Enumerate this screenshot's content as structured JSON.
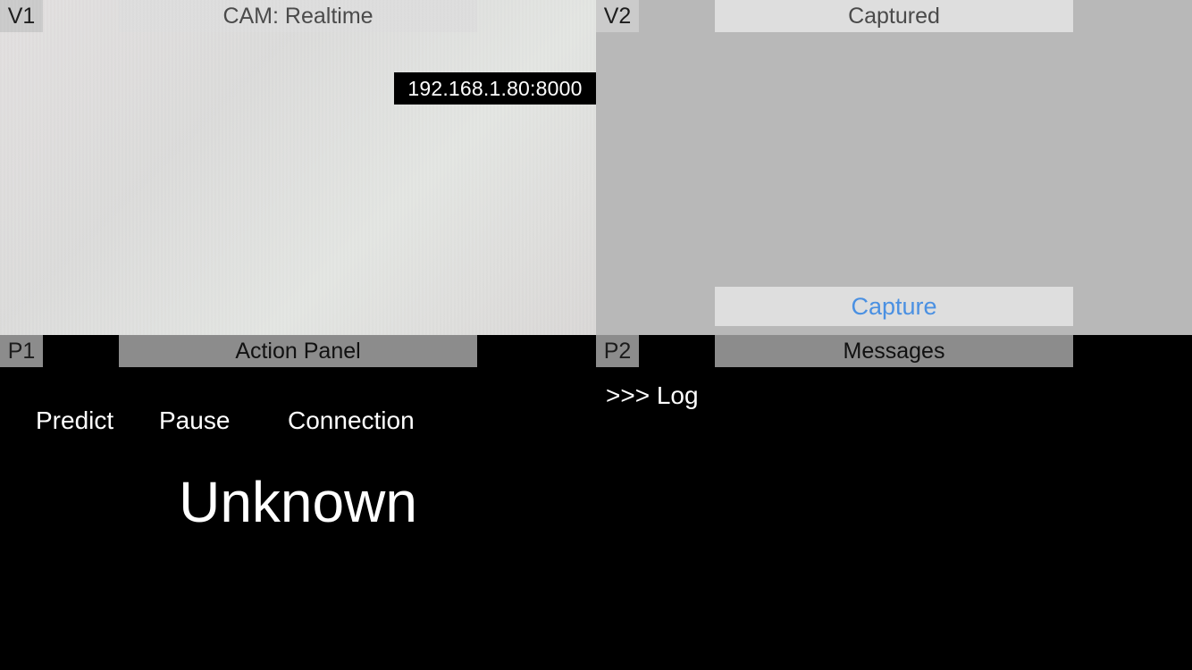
{
  "v1": {
    "tag": "V1",
    "title": "CAM: Realtime",
    "ip_overlay": "192.168.1.80:8000"
  },
  "v2": {
    "tag": "V2",
    "title": "Captured",
    "capture_label": "Capture"
  },
  "p1": {
    "tag": "P1",
    "title": "Action Panel",
    "buttons": {
      "predict": "Predict",
      "pause": "Pause",
      "connection": "Connection"
    },
    "status": "Unknown"
  },
  "p2": {
    "tag": "P2",
    "title": "Messages",
    "log": ">>> Log"
  },
  "colors": {
    "capture_text": "#4a90e2",
    "v2_background": "#b8b8b8",
    "panel_background": "#000000"
  }
}
